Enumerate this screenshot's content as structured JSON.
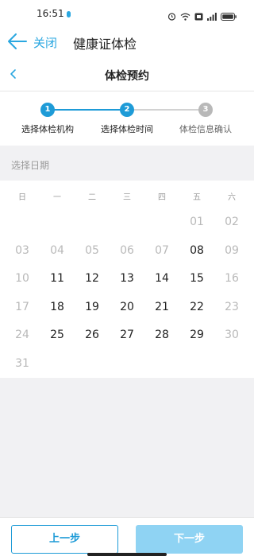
{
  "status_bar": {
    "time": "16:51"
  },
  "app_bar": {
    "close_label": "关闭",
    "title": "健康证体检"
  },
  "sub_header": {
    "title": "体检预约"
  },
  "steps": [
    {
      "number": "1",
      "label": "选择体检机构",
      "state": "done"
    },
    {
      "number": "2",
      "label": "选择体检时间",
      "state": "active"
    },
    {
      "number": "3",
      "label": "体检信息确认",
      "state": "pending"
    }
  ],
  "date_section": {
    "caption": "选择日期"
  },
  "calendar": {
    "weekdays": [
      "日",
      "一",
      "二",
      "三",
      "四",
      "五",
      "六"
    ],
    "weeks": [
      [
        null,
        null,
        null,
        null,
        null,
        {
          "label": "01",
          "available": false
        },
        {
          "label": "02",
          "available": false
        }
      ],
      [
        {
          "label": "03",
          "available": false
        },
        {
          "label": "04",
          "available": false
        },
        {
          "label": "05",
          "available": false
        },
        {
          "label": "06",
          "available": false
        },
        {
          "label": "07",
          "available": false
        },
        {
          "label": "08",
          "available": true
        },
        {
          "label": "09",
          "available": false
        }
      ],
      [
        {
          "label": "10",
          "available": false
        },
        {
          "label": "11",
          "available": true
        },
        {
          "label": "12",
          "available": true
        },
        {
          "label": "13",
          "available": true
        },
        {
          "label": "14",
          "available": true
        },
        {
          "label": "15",
          "available": true
        },
        {
          "label": "16",
          "available": false
        }
      ],
      [
        {
          "label": "17",
          "available": false
        },
        {
          "label": "18",
          "available": true
        },
        {
          "label": "19",
          "available": true
        },
        {
          "label": "20",
          "available": true
        },
        {
          "label": "21",
          "available": true
        },
        {
          "label": "22",
          "available": true
        },
        {
          "label": "23",
          "available": false
        }
      ],
      [
        {
          "label": "24",
          "available": false
        },
        {
          "label": "25",
          "available": true
        },
        {
          "label": "26",
          "available": true
        },
        {
          "label": "27",
          "available": true
        },
        {
          "label": "28",
          "available": true
        },
        {
          "label": "29",
          "available": true
        },
        {
          "label": "30",
          "available": false
        }
      ],
      [
        {
          "label": "31",
          "available": false
        },
        null,
        null,
        null,
        null,
        null,
        null
      ]
    ]
  },
  "buttons": {
    "prev_label": "上一步",
    "next_label": "下一步"
  },
  "colors": {
    "accent": "#1e9bd7",
    "step_pending": "#b8b8b8",
    "day_available": "#222222",
    "day_unavailable": "#b9b9b9",
    "next_disabled": "#8fd3f3"
  }
}
